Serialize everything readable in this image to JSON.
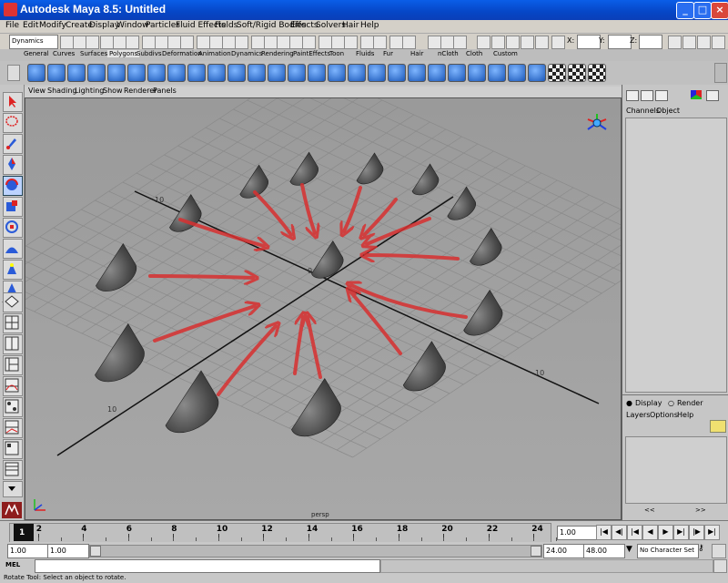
{
  "window": {
    "title": "Autodesk Maya 8.5: Untitled",
    "buttons": [
      "_",
      "□",
      "×"
    ]
  },
  "menubar": [
    "File",
    "Edit",
    "Modify",
    "Create",
    "Display",
    "Window",
    "Particles",
    "Fluid Effects",
    "Fields",
    "Soft/Rigid Bodies",
    "Effects",
    "Solvers",
    "Hair",
    "Help"
  ],
  "statusline": {
    "menu_set": "Dynamics",
    "coord_labels": [
      "X:",
      "Y:",
      "Z:"
    ]
  },
  "shelf_tabs": [
    "General",
    "Curves",
    "Surfaces",
    "Polygons",
    "Subdivs",
    "Deformation",
    "Animation",
    "Dynamics",
    "Rendering",
    "PaintEffects",
    "Toon",
    "Fluids",
    "Fur",
    "Hair",
    "nCloth",
    "Cloth",
    "Custom"
  ],
  "panel_menu": [
    "View",
    "Shading",
    "Lighting",
    "Show",
    "Renderer",
    "Panels"
  ],
  "viewport": {
    "camera_label": "persp",
    "grid_labels": [
      "10",
      "0",
      "10",
      "10"
    ],
    "axis_colors": {
      "x": "#e02020",
      "y": "#20c020",
      "z": "#2040e0"
    },
    "annotation_color": "#d83030"
  },
  "channel_box": {
    "menu": [
      "Channels",
      "Object"
    ]
  },
  "layer_editor": {
    "radios": [
      "Display",
      "Render"
    ],
    "menu": [
      "Layers",
      "Options",
      "Help"
    ],
    "nav": [
      "<<",
      ">>"
    ]
  },
  "timeline": {
    "ticks": [
      "1",
      "2",
      "4",
      "6",
      "8",
      "10",
      "12",
      "14",
      "16",
      "18",
      "20",
      "22",
      "24"
    ],
    "current_time": "1.00"
  },
  "range": {
    "start": "1.00",
    "playback_start": "1.00",
    "playback_end": "24.00",
    "end": "48.00",
    "character_set": "No Character Set"
  },
  "command": {
    "language": "MEL"
  },
  "help_line": "Rotate Tool: Select an object to rotate."
}
